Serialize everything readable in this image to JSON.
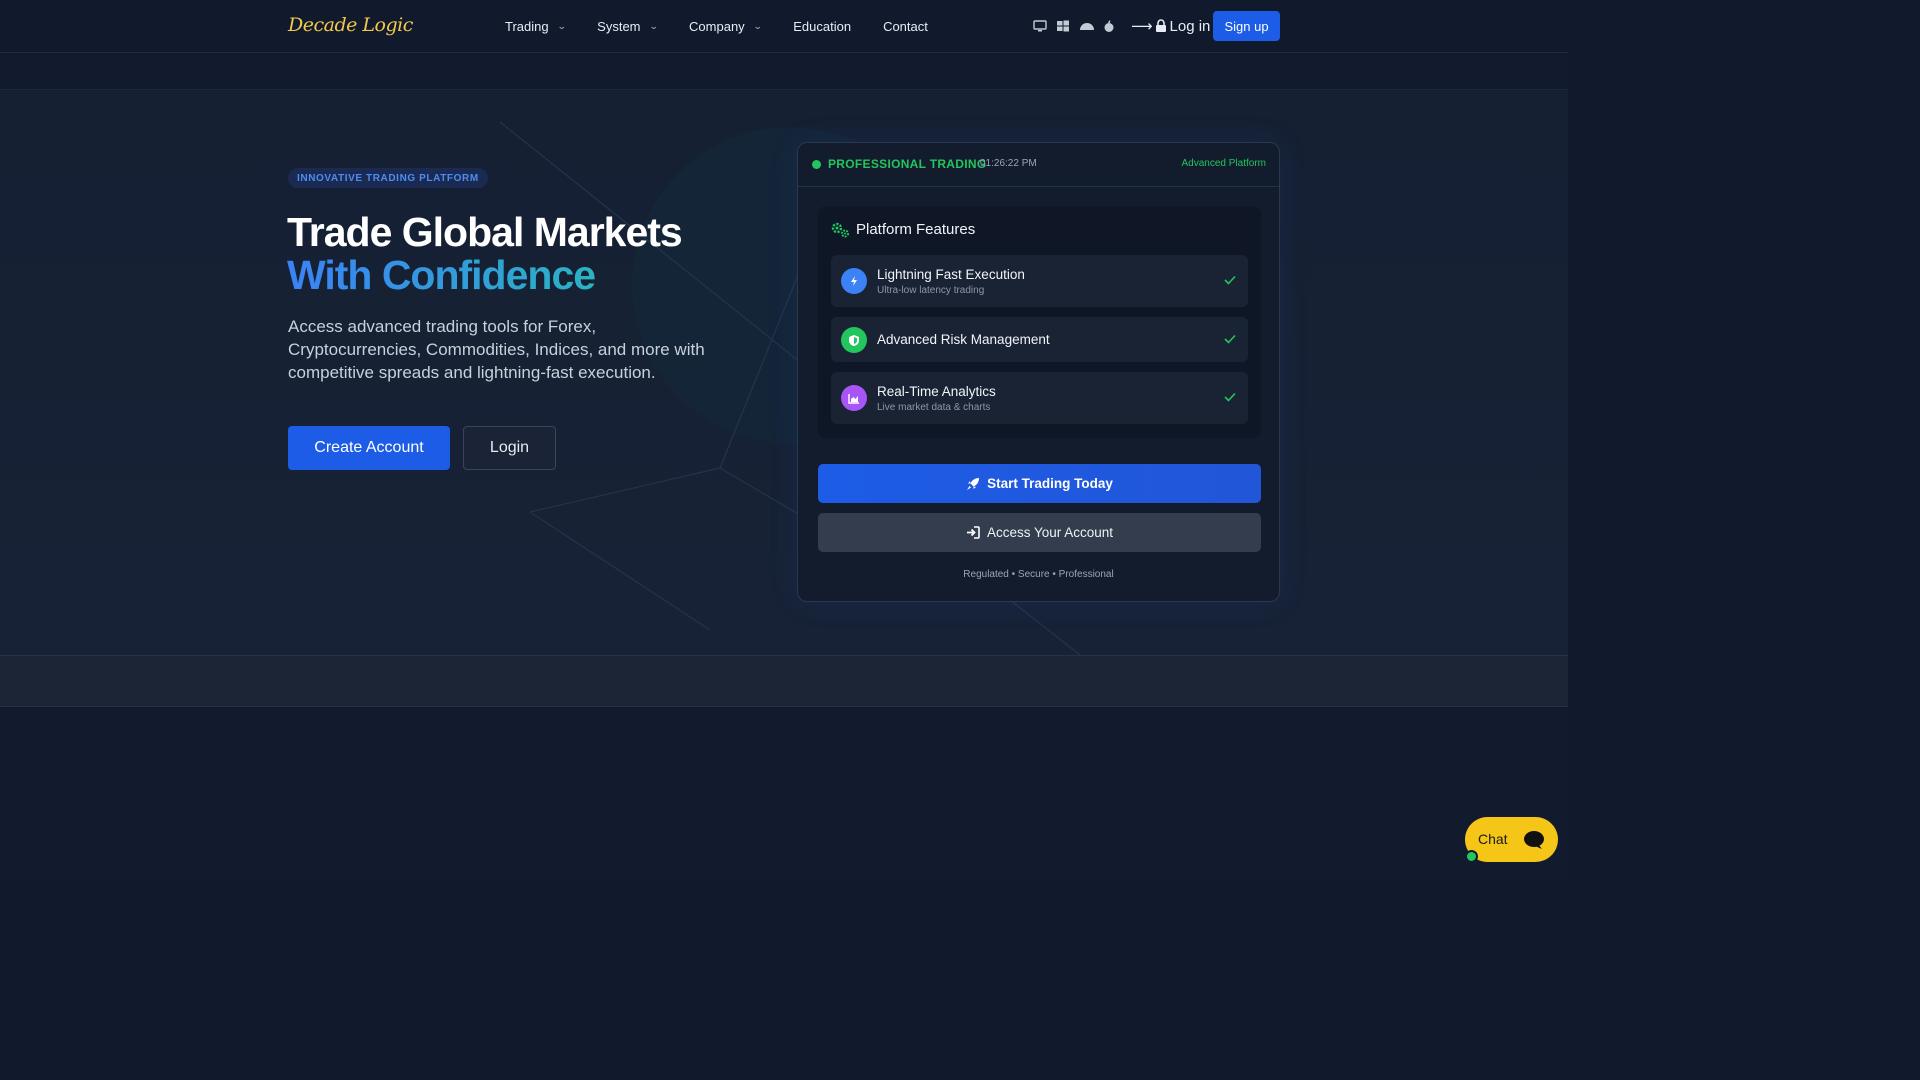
{
  "nav": {
    "logo": "Decade Logic",
    "links": [
      {
        "label": "Trading",
        "dropdown": true
      },
      {
        "label": "System",
        "dropdown": true
      },
      {
        "label": "Company",
        "dropdown": true
      },
      {
        "label": "Education",
        "dropdown": false
      },
      {
        "label": "Contact",
        "dropdown": false
      }
    ],
    "platform_icons": [
      "desktop-icon",
      "windows-icon",
      "android-icon",
      "apple-icon"
    ],
    "login_label": "Log in",
    "signup_label": "Sign up"
  },
  "hero": {
    "badge": "INNOVATIVE TRADING PLATFORM",
    "title_line1": "Trade Global Markets",
    "title_line2": "With Confidence",
    "lead": "Access advanced trading tools for Forex, Cryptocurrencies, Commodities, Indices, and more with competitive spreads and lightning-fast execution.",
    "create_account_label": "Create Account",
    "login_label": "Login"
  },
  "card": {
    "status_label": "PROFESSIONAL TRADING",
    "time": "01:26:22 PM",
    "platform_tag": "Advanced Platform",
    "features_title": "Platform Features",
    "features": [
      {
        "name": "Lightning Fast Execution",
        "sub": "Ultra-low latency trading",
        "icon": "lightning-icon",
        "color": "#3b82f6"
      },
      {
        "name": "Advanced Risk Management",
        "sub": "",
        "icon": "shield-icon",
        "color": "#22c55e"
      },
      {
        "name": "Real-Time Analytics",
        "sub": "Live market data & charts",
        "icon": "chart-icon",
        "color": "#a855f7"
      }
    ],
    "start_label": "Start Trading Today",
    "access_label": "Access Your Account",
    "footnote": "Regulated • Secure • Professional"
  },
  "chat": {
    "label": "Chat"
  },
  "colors": {
    "accent": "#1d5ce6",
    "green": "#22c55e",
    "logo": "#f2c94c",
    "background": "#111a2c",
    "chat": "#f5c518"
  }
}
